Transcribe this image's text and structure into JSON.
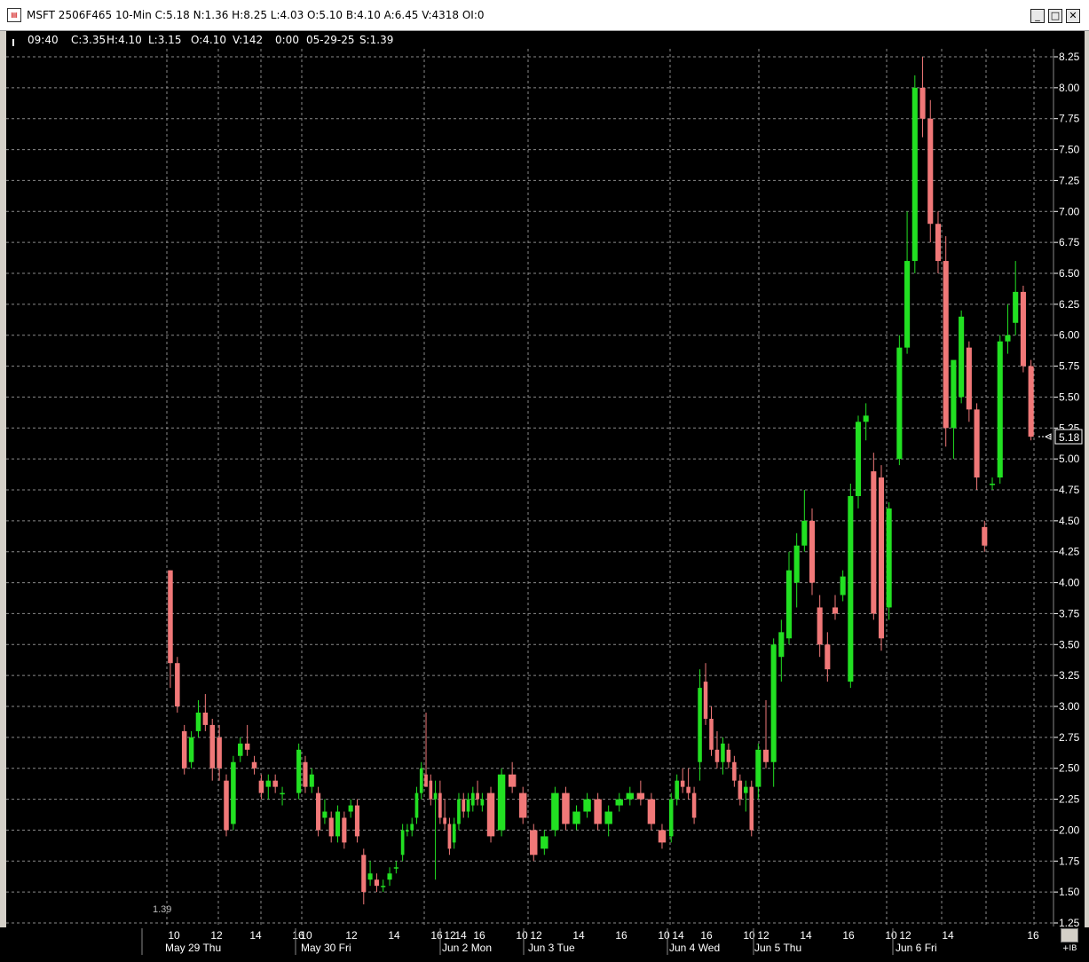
{
  "window": {
    "title": "MSFT 2506F465 10-Min C:5.18 N:1.36 H:8.25 L:4.03 O:5.10 B:4.10 A:6.45 V:4318 OI:0",
    "icon": "chart-app-icon",
    "minimize_icon": "minimize-icon",
    "maximize_icon": "maximize-icon",
    "close_icon": "close-icon"
  },
  "info_bar": {
    "time": "09:40",
    "close": "C:3.35",
    "high": "H:4.10",
    "low": "L:3.15",
    "open": "O:4.10",
    "volume": "V:142",
    "change": "0:00",
    "date": "05-29-25",
    "s": "S:1.39"
  },
  "price_axis": {
    "ticks": [
      "8.25",
      "8.00",
      "7.75",
      "7.50",
      "7.25",
      "7.00",
      "6.75",
      "6.50",
      "6.25",
      "6.00",
      "5.75",
      "5.50",
      "5.25",
      "5.00",
      "4.75",
      "4.50",
      "4.25",
      "4.00",
      "3.75",
      "3.50",
      "3.25",
      "3.00",
      "2.75",
      "2.50",
      "2.25",
      "2.00",
      "1.75",
      "1.50",
      "1.25"
    ],
    "last_price": "5.18"
  },
  "low_marker_label": "1.39",
  "time_axis": {
    "tick_labels": [
      "10",
      "12",
      "14",
      "16",
      "10",
      "12",
      "14",
      "16",
      "12",
      "14",
      "16",
      "10",
      "12",
      "14",
      "16",
      "10",
      "14",
      "16",
      "10",
      "12",
      "14",
      "16",
      "10",
      "12",
      "14",
      "16"
    ],
    "day_labels": [
      "May 29 Thu",
      "May 30 Fri",
      "Jun 2 Mon",
      "Jun 3 Tue",
      "Jun 4 Wed",
      "Jun 5 Thu",
      "Jun 6 Fri"
    ]
  },
  "ib_label": "+IB",
  "colors": {
    "background": "#000000",
    "up": "#22e022",
    "down": "#f07878",
    "grid": "#8a8a8a",
    "text": "#ffffff"
  },
  "chart_data": {
    "type": "candlestick",
    "title": "MSFT 2506F465 10-Min",
    "ylim": [
      1.25,
      8.3
    ],
    "y_ticks": [
      1.25,
      1.5,
      1.75,
      2.0,
      2.25,
      2.5,
      2.75,
      3.0,
      3.25,
      3.5,
      3.75,
      4.0,
      4.25,
      4.5,
      4.75,
      5.0,
      5.25,
      5.5,
      5.75,
      6.0,
      6.25,
      6.5,
      6.75,
      7.0,
      7.25,
      7.5,
      7.75,
      8.0,
      8.25
    ],
    "last": 5.18,
    "days": [
      {
        "day": "May 29 Thu",
        "bars": [
          [
            4.1,
            4.1,
            3.15,
            3.35
          ],
          [
            3.35,
            3.4,
            2.95,
            3.0
          ],
          [
            2.8,
            2.85,
            2.45,
            2.5
          ],
          [
            2.55,
            2.8,
            2.5,
            2.75
          ],
          [
            2.8,
            3.05,
            2.75,
            2.95
          ],
          [
            2.95,
            3.1,
            2.8,
            2.85
          ],
          [
            2.85,
            2.9,
            2.4,
            2.5
          ],
          [
            2.75,
            2.85,
            2.4,
            2.5
          ],
          [
            2.4,
            2.45,
            1.95,
            2.0
          ],
          [
            2.05,
            2.6,
            2.0,
            2.55
          ],
          [
            2.6,
            2.75,
            2.55,
            2.7
          ],
          [
            2.7,
            2.85,
            2.6,
            2.65
          ],
          [
            2.55,
            2.6,
            2.45,
            2.5
          ],
          [
            2.4,
            2.45,
            2.25,
            2.3
          ],
          [
            2.35,
            2.45,
            2.25,
            2.4
          ],
          [
            2.4,
            2.45,
            2.3,
            2.35
          ],
          [
            2.3,
            2.35,
            2.2,
            2.3
          ]
        ]
      },
      {
        "day": "May 30 Fri",
        "bars": [
          [
            2.3,
            2.7,
            2.25,
            2.65
          ],
          [
            2.55,
            2.6,
            2.3,
            2.35
          ],
          [
            2.35,
            2.5,
            2.3,
            2.45
          ],
          [
            2.3,
            2.35,
            1.95,
            2.0
          ],
          [
            2.1,
            2.25,
            2.05,
            2.15
          ],
          [
            2.1,
            2.15,
            1.9,
            1.95
          ],
          [
            1.95,
            2.2,
            1.9,
            2.15
          ],
          [
            2.1,
            2.15,
            1.85,
            1.9
          ],
          [
            2.15,
            2.25,
            2.1,
            2.2
          ],
          [
            2.2,
            2.25,
            1.9,
            1.95
          ],
          [
            1.8,
            1.85,
            1.4,
            1.5
          ],
          [
            1.6,
            1.75,
            1.55,
            1.65
          ],
          [
            1.6,
            1.65,
            1.5,
            1.55
          ],
          [
            1.55,
            1.6,
            1.5,
            1.55
          ],
          [
            1.6,
            1.7,
            1.55,
            1.65
          ],
          [
            1.7,
            1.75,
            1.65,
            1.7
          ]
        ]
      },
      {
        "day": "Jun 2 Mon",
        "bars": [
          [
            1.8,
            2.05,
            1.75,
            2.0
          ],
          [
            2.0,
            2.05,
            1.95,
            2.0
          ],
          [
            2.0,
            2.1,
            1.95,
            2.05
          ],
          [
            2.1,
            2.35,
            2.05,
            2.3
          ],
          [
            2.3,
            2.55,
            2.25,
            2.5
          ],
          [
            2.45,
            2.95,
            2.4,
            2.35
          ],
          [
            2.4,
            2.45,
            2.2,
            2.25
          ],
          [
            2.25,
            2.4,
            1.6,
            2.3
          ],
          [
            2.3,
            2.4,
            2.05,
            2.1
          ],
          [
            2.1,
            2.25,
            2.0,
            2.05
          ],
          [
            2.05,
            2.1,
            1.8,
            1.85
          ],
          [
            1.9,
            2.1,
            1.85,
            2.05
          ],
          [
            2.05,
            2.3,
            2.0,
            2.25
          ],
          [
            2.25,
            2.3,
            2.1,
            2.15
          ],
          [
            2.15,
            2.3,
            2.1,
            2.25
          ],
          [
            2.2,
            2.35,
            2.15,
            2.3
          ],
          [
            2.3,
            2.4,
            2.2,
            2.25
          ],
          [
            2.2,
            2.3,
            2.15,
            2.25
          ]
        ]
      },
      {
        "day": "Jun 3 Tue",
        "bars": [
          [
            2.3,
            2.35,
            1.9,
            1.95
          ],
          [
            2.0,
            2.5,
            1.95,
            2.45
          ],
          [
            2.45,
            2.55,
            2.3,
            2.35
          ],
          [
            2.3,
            2.35,
            2.05,
            2.1
          ],
          [
            2.0,
            2.05,
            1.75,
            1.8
          ],
          [
            1.85,
            2.0,
            1.8,
            1.95
          ],
          [
            2.0,
            2.35,
            1.95,
            2.3
          ],
          [
            2.3,
            2.35,
            2.0,
            2.05
          ],
          [
            2.05,
            2.2,
            2.0,
            2.15
          ],
          [
            2.15,
            2.3,
            2.1,
            2.25
          ],
          [
            2.25,
            2.3,
            2.0,
            2.05
          ],
          [
            2.05,
            2.2,
            1.95,
            2.15
          ],
          [
            2.2,
            2.3,
            2.15,
            2.25
          ],
          [
            2.25,
            2.35,
            2.2,
            2.3
          ],
          [
            2.3,
            2.4,
            2.2,
            2.25
          ],
          [
            2.25,
            2.3,
            2.0,
            2.05
          ],
          [
            2.0,
            2.05,
            1.85,
            1.9
          ]
        ]
      },
      {
        "day": "Jun 4 Wed",
        "bars": [
          [
            1.95,
            2.3,
            1.9,
            2.25
          ],
          [
            2.25,
            2.45,
            2.2,
            2.4
          ],
          [
            2.4,
            2.5,
            2.3,
            2.35
          ],
          [
            2.35,
            2.5,
            2.25,
            2.3
          ],
          [
            2.3,
            2.35,
            2.05,
            2.1
          ],
          [
            2.55,
            3.3,
            2.4,
            3.15
          ],
          [
            3.2,
            3.35,
            2.85,
            2.9
          ],
          [
            2.9,
            3.0,
            2.6,
            2.65
          ],
          [
            2.65,
            2.8,
            2.5,
            2.55
          ],
          [
            2.55,
            2.75,
            2.45,
            2.7
          ],
          [
            2.65,
            2.7,
            2.5,
            2.55
          ],
          [
            2.55,
            2.6,
            2.35,
            2.4
          ],
          [
            2.4,
            2.45,
            2.2,
            2.25
          ],
          [
            2.3,
            2.4,
            2.15,
            2.35
          ],
          [
            2.35,
            2.4,
            1.95,
            2.0
          ]
        ]
      },
      {
        "day": "Jun 5 Thu",
        "bars": [
          [
            2.35,
            2.7,
            2.25,
            2.65
          ],
          [
            2.65,
            3.05,
            2.5,
            2.55
          ],
          [
            2.55,
            3.55,
            2.35,
            3.5
          ],
          [
            3.4,
            3.7,
            3.2,
            3.6
          ],
          [
            3.55,
            4.25,
            3.5,
            4.1
          ],
          [
            4.0,
            4.4,
            3.8,
            4.3
          ],
          [
            4.3,
            4.75,
            4.25,
            4.5
          ],
          [
            4.5,
            4.6,
            3.9,
            4.0
          ],
          [
            3.8,
            3.9,
            3.4,
            3.5
          ],
          [
            3.5,
            3.6,
            3.2,
            3.3
          ],
          [
            3.8,
            3.9,
            3.7,
            3.75
          ],
          [
            3.9,
            4.1,
            3.85,
            4.05
          ],
          [
            3.2,
            4.8,
            3.15,
            4.7
          ],
          [
            4.7,
            5.35,
            4.6,
            5.3
          ],
          [
            5.3,
            5.45,
            5.15,
            5.35
          ],
          [
            4.9,
            5.05,
            3.7,
            3.75
          ],
          [
            4.85,
            4.95,
            3.45,
            3.55
          ],
          [
            3.8,
            4.65,
            3.7,
            4.6
          ]
        ]
      },
      {
        "day": "Jun 6 Fri",
        "bars": [
          [
            5.0,
            6.0,
            4.95,
            5.9
          ],
          [
            5.9,
            7.0,
            5.85,
            6.6
          ],
          [
            6.6,
            8.1,
            6.5,
            8.0
          ],
          [
            8.0,
            8.25,
            7.6,
            7.75
          ],
          [
            7.75,
            7.9,
            6.75,
            6.9
          ],
          [
            6.9,
            7.0,
            6.5,
            6.6
          ],
          [
            6.6,
            6.8,
            5.1,
            5.25
          ],
          [
            5.25,
            5.6,
            5.0,
            5.8
          ],
          [
            5.5,
            6.2,
            5.45,
            6.15
          ],
          [
            5.9,
            5.95,
            5.3,
            5.4
          ],
          [
            5.4,
            5.45,
            4.75,
            4.85
          ],
          [
            4.45,
            4.5,
            4.25,
            4.3
          ],
          [
            4.8,
            4.85,
            4.75,
            4.8
          ],
          [
            4.85,
            6.0,
            4.8,
            5.95
          ],
          [
            5.95,
            6.25,
            5.85,
            6.0
          ],
          [
            6.1,
            6.6,
            6.0,
            6.35
          ],
          [
            6.35,
            6.4,
            5.7,
            5.75
          ],
          [
            5.75,
            5.8,
            5.15,
            5.18
          ]
        ]
      }
    ]
  }
}
